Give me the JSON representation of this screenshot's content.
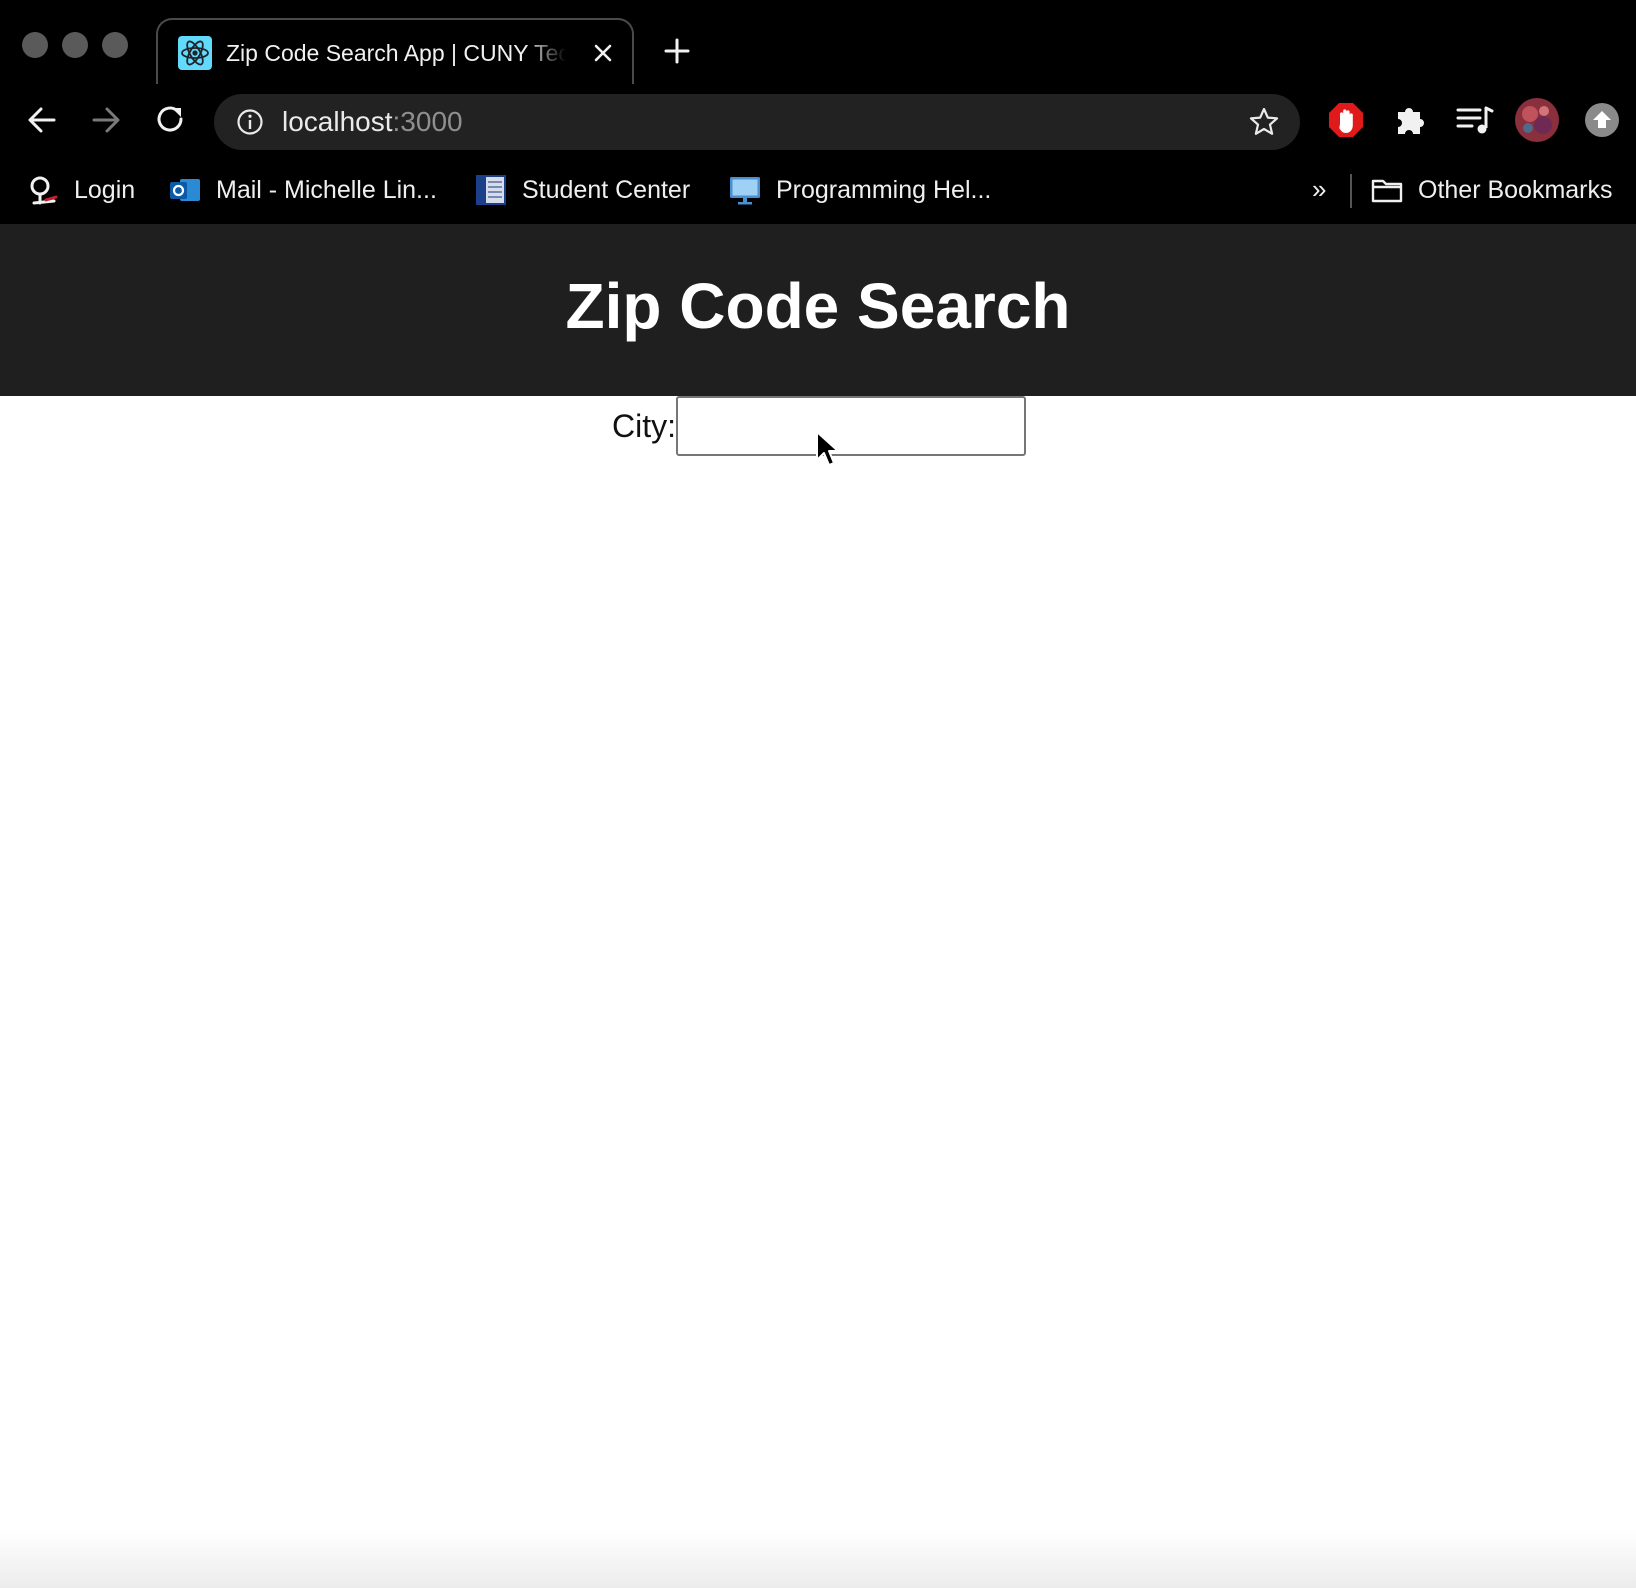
{
  "tab": {
    "title": "Zip Code Search App | CUNY Tech Prep",
    "favicon": "react-atom-icon"
  },
  "address_bar": {
    "host": "localhost",
    "port": ":3000"
  },
  "bookmarks": {
    "items": [
      {
        "label": "Login",
        "icon": "login-favicon-icon"
      },
      {
        "label": "Mail - Michelle Lin...",
        "icon": "outlook-icon"
      },
      {
        "label": "Student Center",
        "icon": "student-center-icon"
      },
      {
        "label": "Programming Hel...",
        "icon": "monitor-icon"
      }
    ],
    "more_label": "»",
    "other_label": "Other Bookmarks"
  },
  "app": {
    "title": "Zip Code Search",
    "city_label": "City:",
    "city_value": ""
  },
  "colors": {
    "header_bg": "#1f1f1f",
    "chrome_bg": "#000000",
    "react_blue": "#61dafb",
    "adblock_red": "#e0191b"
  }
}
